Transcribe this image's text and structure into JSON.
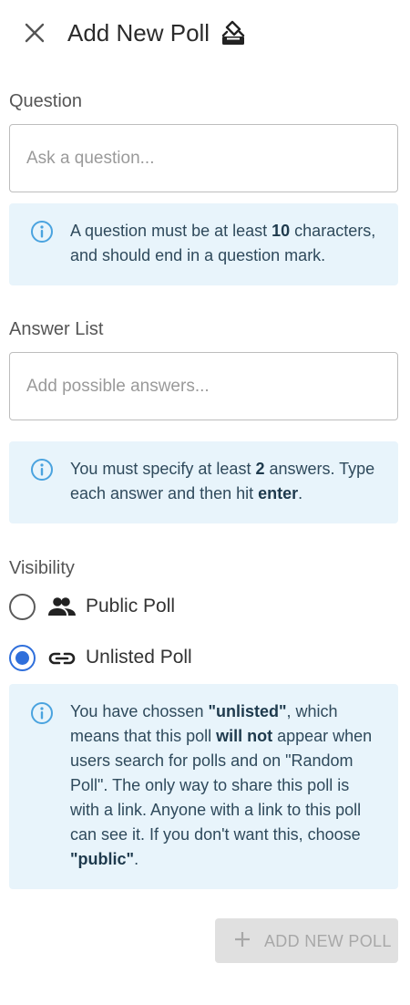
{
  "header": {
    "title": "Add New Poll",
    "close_icon": "close-icon",
    "title_icon": "ballot-box-icon"
  },
  "question": {
    "label": "Question",
    "placeholder": "Ask a question...",
    "value": "",
    "info": {
      "prefix": "A question must be at least ",
      "min_chars": "10",
      "suffix": " characters, and should end in a question mark."
    }
  },
  "answers": {
    "label": "Answer List",
    "placeholder": "Add possible answers...",
    "value": "",
    "info": {
      "prefix": "You must specify at least ",
      "min_answers": "2",
      "middle": " answers. Type each answer and then hit ",
      "key": "enter",
      "suffix": "."
    }
  },
  "visibility": {
    "label": "Visibility",
    "options": [
      {
        "label": "Public Poll",
        "icon": "people-icon",
        "selected": false
      },
      {
        "label": "Unlisted Poll",
        "icon": "link-icon",
        "selected": true
      }
    ],
    "info": {
      "p1": "You have chossen ",
      "b1": "\"unlisted\"",
      "p2": ", which means that this poll ",
      "b2": "will not",
      "p3": " appear when users search for polls and on \"Random Poll\". The only way to share this poll is with a link. Anyone with a link to this poll can see it. If you don't want this, choose ",
      "b3": "\"public\"",
      "p4": "."
    }
  },
  "submit": {
    "label": "ADD NEW POLL",
    "icon": "plus-icon",
    "disabled": true
  },
  "colors": {
    "accent": "#2f6fdb",
    "info_bg": "#e8f4fb",
    "info_icon": "#4aa3df",
    "disabled_bg": "#e0e0e0"
  }
}
